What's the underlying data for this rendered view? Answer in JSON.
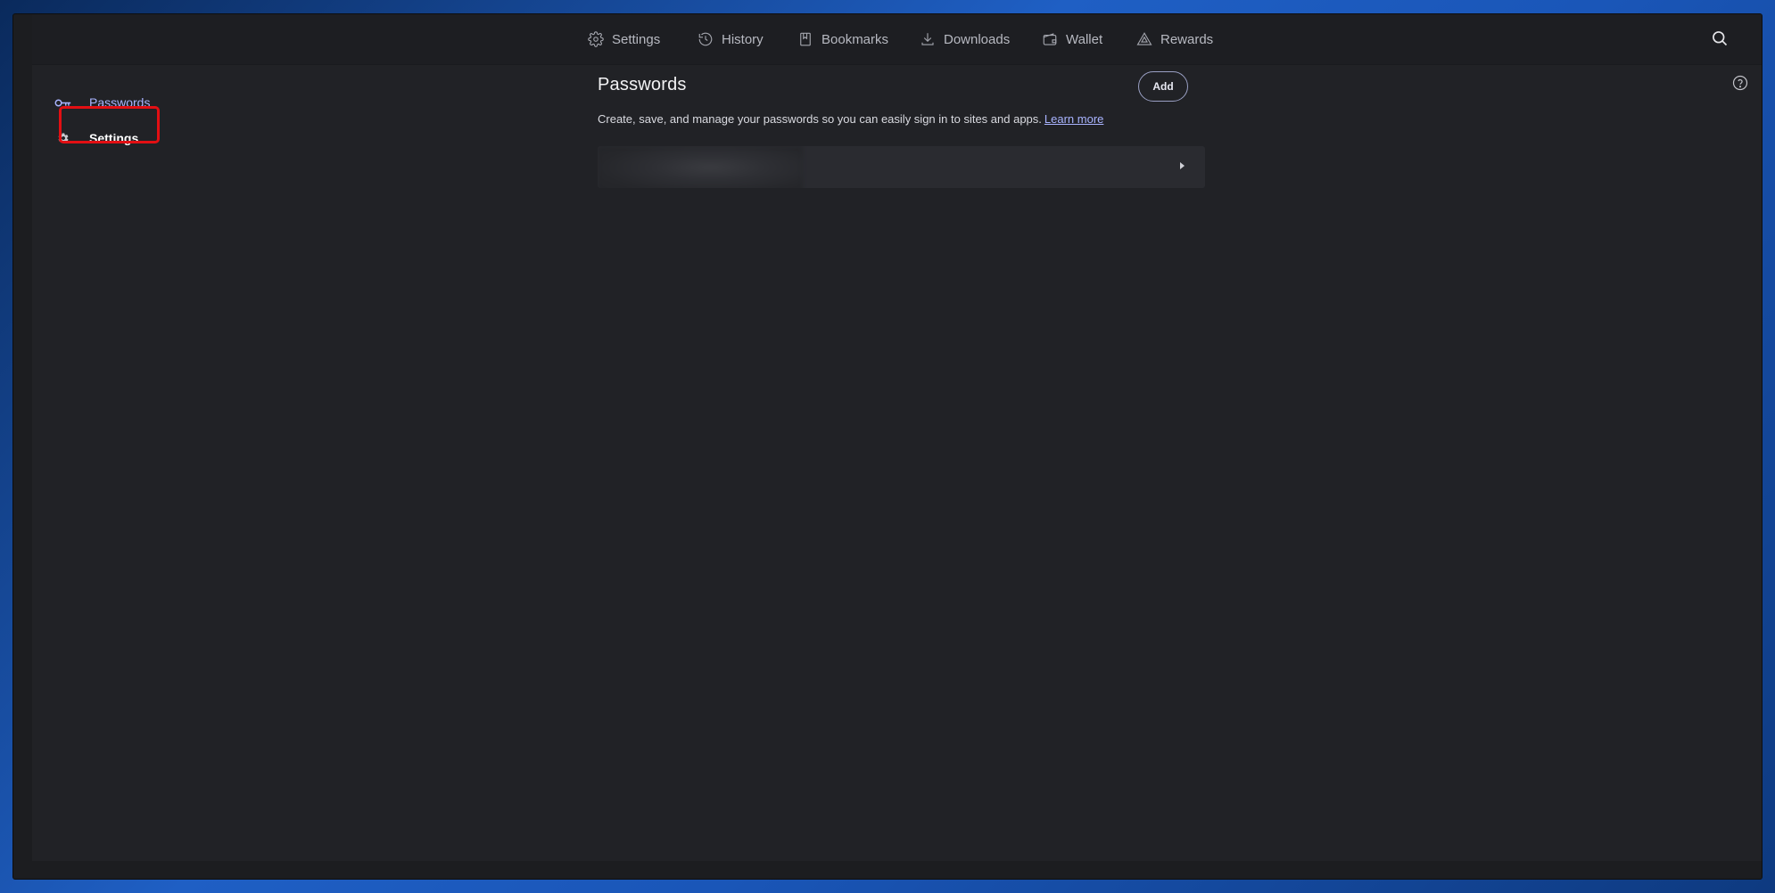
{
  "topnav": {
    "items": [
      {
        "label": "Settings",
        "icon": "gear-icon"
      },
      {
        "label": "History",
        "icon": "history-icon"
      },
      {
        "label": "Bookmarks",
        "icon": "bookmark-icon"
      },
      {
        "label": "Downloads",
        "icon": "download-icon"
      },
      {
        "label": "Wallet",
        "icon": "wallet-icon"
      },
      {
        "label": "Rewards",
        "icon": "rewards-triangle-icon"
      }
    ],
    "search_icon": "search-icon"
  },
  "sidebar": {
    "items": [
      {
        "label": "Passwords",
        "icon": "key-icon",
        "active": true
      },
      {
        "label": "Settings",
        "icon": "gear-icon",
        "active": false
      }
    ]
  },
  "main": {
    "title": "Passwords",
    "add_label": "Add",
    "description": "Create, save, and manage your passwords so you can easily sign in to sites and apps.",
    "learn_more": "Learn more",
    "help_icon": "help-circle-icon"
  },
  "colors": {
    "accent": "#a9b4ff",
    "highlight": "#e20f13",
    "background": "#212226"
  }
}
